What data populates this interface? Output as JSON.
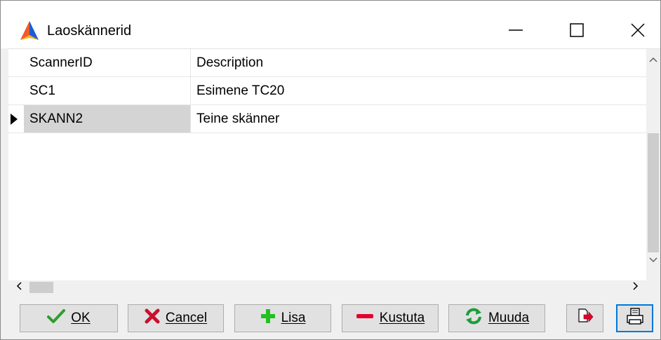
{
  "window": {
    "title": "Laoskännerid"
  },
  "grid": {
    "columns": [
      "ScannerID",
      "Description"
    ],
    "rows": [
      {
        "id": "SC1",
        "description": "Esimene TC20",
        "selected": false
      },
      {
        "id": "SKANN2",
        "description": "Teine skänner",
        "selected": true
      }
    ]
  },
  "buttons": {
    "ok": "OK",
    "cancel": "Cancel",
    "add": "Lisa",
    "delete": "Kustuta",
    "edit": "Muuda"
  },
  "icons": {
    "app": "app-logo-icon",
    "minimize": "minimize-icon",
    "maximize": "maximize-icon",
    "close": "close-icon",
    "ok": "checkmark-icon",
    "cancel": "x-icon",
    "add": "plus-icon",
    "delete": "minus-icon",
    "edit": "refresh-icon",
    "export": "export-icon",
    "print": "printer-icon"
  },
  "colors": {
    "selection": "#d4d4d4",
    "focus_border": "#0078d7",
    "ok_green": "#2e9e2e",
    "cancel_red": "#c8102e",
    "add_green": "#22c022",
    "delete_red": "#e4002b",
    "edit_green": "#1a9e3a"
  }
}
